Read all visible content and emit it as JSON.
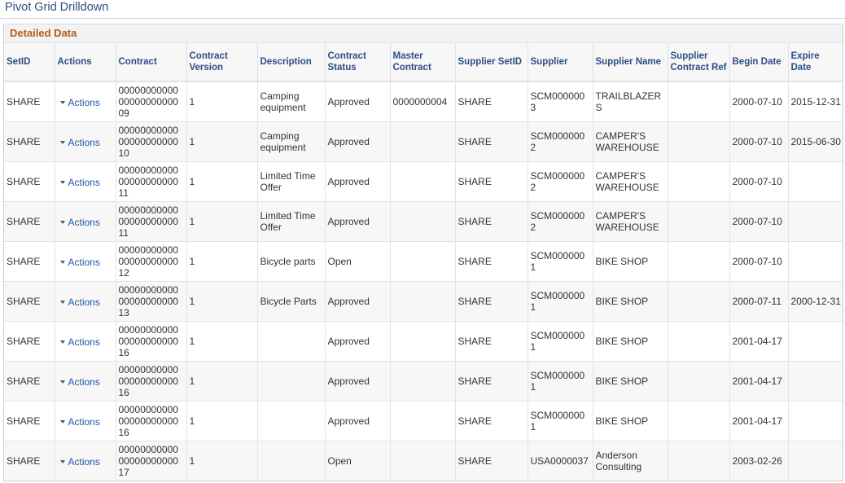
{
  "page": {
    "title": "Pivot Grid Drilldown"
  },
  "section": {
    "title": "Detailed Data"
  },
  "columns": [
    "SetID",
    "Actions",
    "Contract",
    "Contract Version",
    "Description",
    "Contract Status",
    "Master Contract",
    "Supplier SetID",
    "Supplier",
    "Supplier Name",
    "Supplier Contract Ref",
    "Begin Date",
    "Expire Date"
  ],
  "rows": [
    {
      "setid": "SHARE",
      "actions": "Actions",
      "contract": "000000000000000000000009",
      "version": "1",
      "description": "Camping equipment",
      "status": "Approved",
      "master": "0000000004",
      "supplier_setid": "SHARE",
      "supplier": "SCM0000003",
      "supplier_name": "TRAILBLAZERS",
      "supplier_ref": "",
      "begin": "2000-07-10",
      "expire": "2015-12-31"
    },
    {
      "setid": "SHARE",
      "actions": "Actions",
      "contract": "000000000000000000000010",
      "version": "1",
      "description": "Camping equipment",
      "status": "Approved",
      "master": "",
      "supplier_setid": "SHARE",
      "supplier": "SCM0000002",
      "supplier_name": "CAMPER'S WAREHOUSE",
      "supplier_ref": "",
      "begin": "2000-07-10",
      "expire": "2015-06-30"
    },
    {
      "setid": "SHARE",
      "actions": "Actions",
      "contract": "000000000000000000000011",
      "version": "1",
      "description": "Limited Time Offer",
      "status": "Approved",
      "master": "",
      "supplier_setid": "SHARE",
      "supplier": "SCM0000002",
      "supplier_name": "CAMPER'S WAREHOUSE",
      "supplier_ref": "",
      "begin": "2000-07-10",
      "expire": ""
    },
    {
      "setid": "SHARE",
      "actions": "Actions",
      "contract": "000000000000000000000011",
      "version": "1",
      "description": "Limited Time Offer",
      "status": "Approved",
      "master": "",
      "supplier_setid": "SHARE",
      "supplier": "SCM0000002",
      "supplier_name": "CAMPER'S WAREHOUSE",
      "supplier_ref": "",
      "begin": "2000-07-10",
      "expire": ""
    },
    {
      "setid": "SHARE",
      "actions": "Actions",
      "contract": "000000000000000000000012",
      "version": "1",
      "description": "Bicycle parts",
      "status": "Open",
      "master": "",
      "supplier_setid": "SHARE",
      "supplier": "SCM0000001",
      "supplier_name": "BIKE SHOP",
      "supplier_ref": "",
      "begin": "2000-07-10",
      "expire": ""
    },
    {
      "setid": "SHARE",
      "actions": "Actions",
      "contract": "000000000000000000000013",
      "version": "1",
      "description": "Bicycle Parts",
      "status": "Approved",
      "master": "",
      "supplier_setid": "SHARE",
      "supplier": "SCM0000001",
      "supplier_name": "BIKE SHOP",
      "supplier_ref": "",
      "begin": "2000-07-11",
      "expire": "2000-12-31"
    },
    {
      "setid": "SHARE",
      "actions": "Actions",
      "contract": "000000000000000000000016",
      "version": "1",
      "description": "",
      "status": "Approved",
      "master": "",
      "supplier_setid": "SHARE",
      "supplier": "SCM0000001",
      "supplier_name": "BIKE SHOP",
      "supplier_ref": "",
      "begin": "2001-04-17",
      "expire": ""
    },
    {
      "setid": "SHARE",
      "actions": "Actions",
      "contract": "000000000000000000000016",
      "version": "1",
      "description": "",
      "status": "Approved",
      "master": "",
      "supplier_setid": "SHARE",
      "supplier": "SCM0000001",
      "supplier_name": "BIKE SHOP",
      "supplier_ref": "",
      "begin": "2001-04-17",
      "expire": ""
    },
    {
      "setid": "SHARE",
      "actions": "Actions",
      "contract": "000000000000000000000016",
      "version": "1",
      "description": "",
      "status": "Approved",
      "master": "",
      "supplier_setid": "SHARE",
      "supplier": "SCM0000001",
      "supplier_name": "BIKE SHOP",
      "supplier_ref": "",
      "begin": "2001-04-17",
      "expire": ""
    },
    {
      "setid": "SHARE",
      "actions": "Actions",
      "contract": "000000000000000000000017",
      "version": "1",
      "description": "",
      "status": "Open",
      "master": "",
      "supplier_setid": "SHARE",
      "supplier": "USA0000037",
      "supplier_name": "Anderson Consulting",
      "supplier_ref": "",
      "begin": "2003-02-26",
      "expire": ""
    }
  ]
}
